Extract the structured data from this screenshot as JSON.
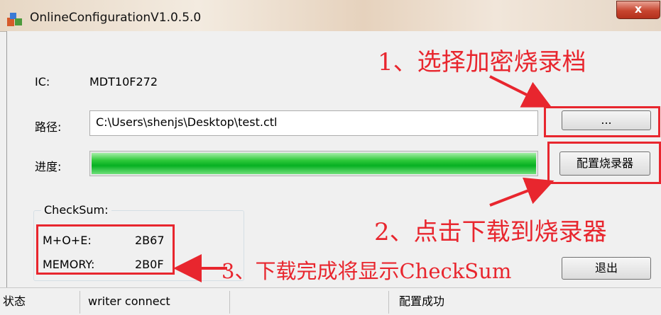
{
  "window": {
    "title": "OnlineConfigurationV1.0.5.0",
    "close_glyph": "x"
  },
  "ic": {
    "label": "IC:",
    "value": "MDT10F272"
  },
  "path": {
    "label": "路径:",
    "value": "C:\\Users\\shenjs\\Desktop\\test.ctl",
    "browse_label": "..."
  },
  "progress": {
    "label": "进度:",
    "value": 1.0
  },
  "configure_button": {
    "label": "配置烧录器"
  },
  "checksum": {
    "title": "CheckSum:",
    "rows": [
      {
        "label": "M+O+E:",
        "value": "2B67"
      },
      {
        "label": "MEMORY:",
        "value": "2B0F"
      }
    ]
  },
  "exit_button": {
    "label": "退出"
  },
  "annotations": {
    "step1": "1、选择加密烧录档",
    "step2": "2、点击下载到烧录器",
    "step3": "3、下载完成将显示CheckSum"
  },
  "statusbar": {
    "state_label": "状态",
    "connection": "writer connect",
    "message": "配置成功"
  },
  "colors": {
    "annotation_red": "#e8262e",
    "progress_green": "#06b022",
    "close_red": "#c7452f"
  },
  "icons": [
    "app-icon",
    "close-icon"
  ]
}
